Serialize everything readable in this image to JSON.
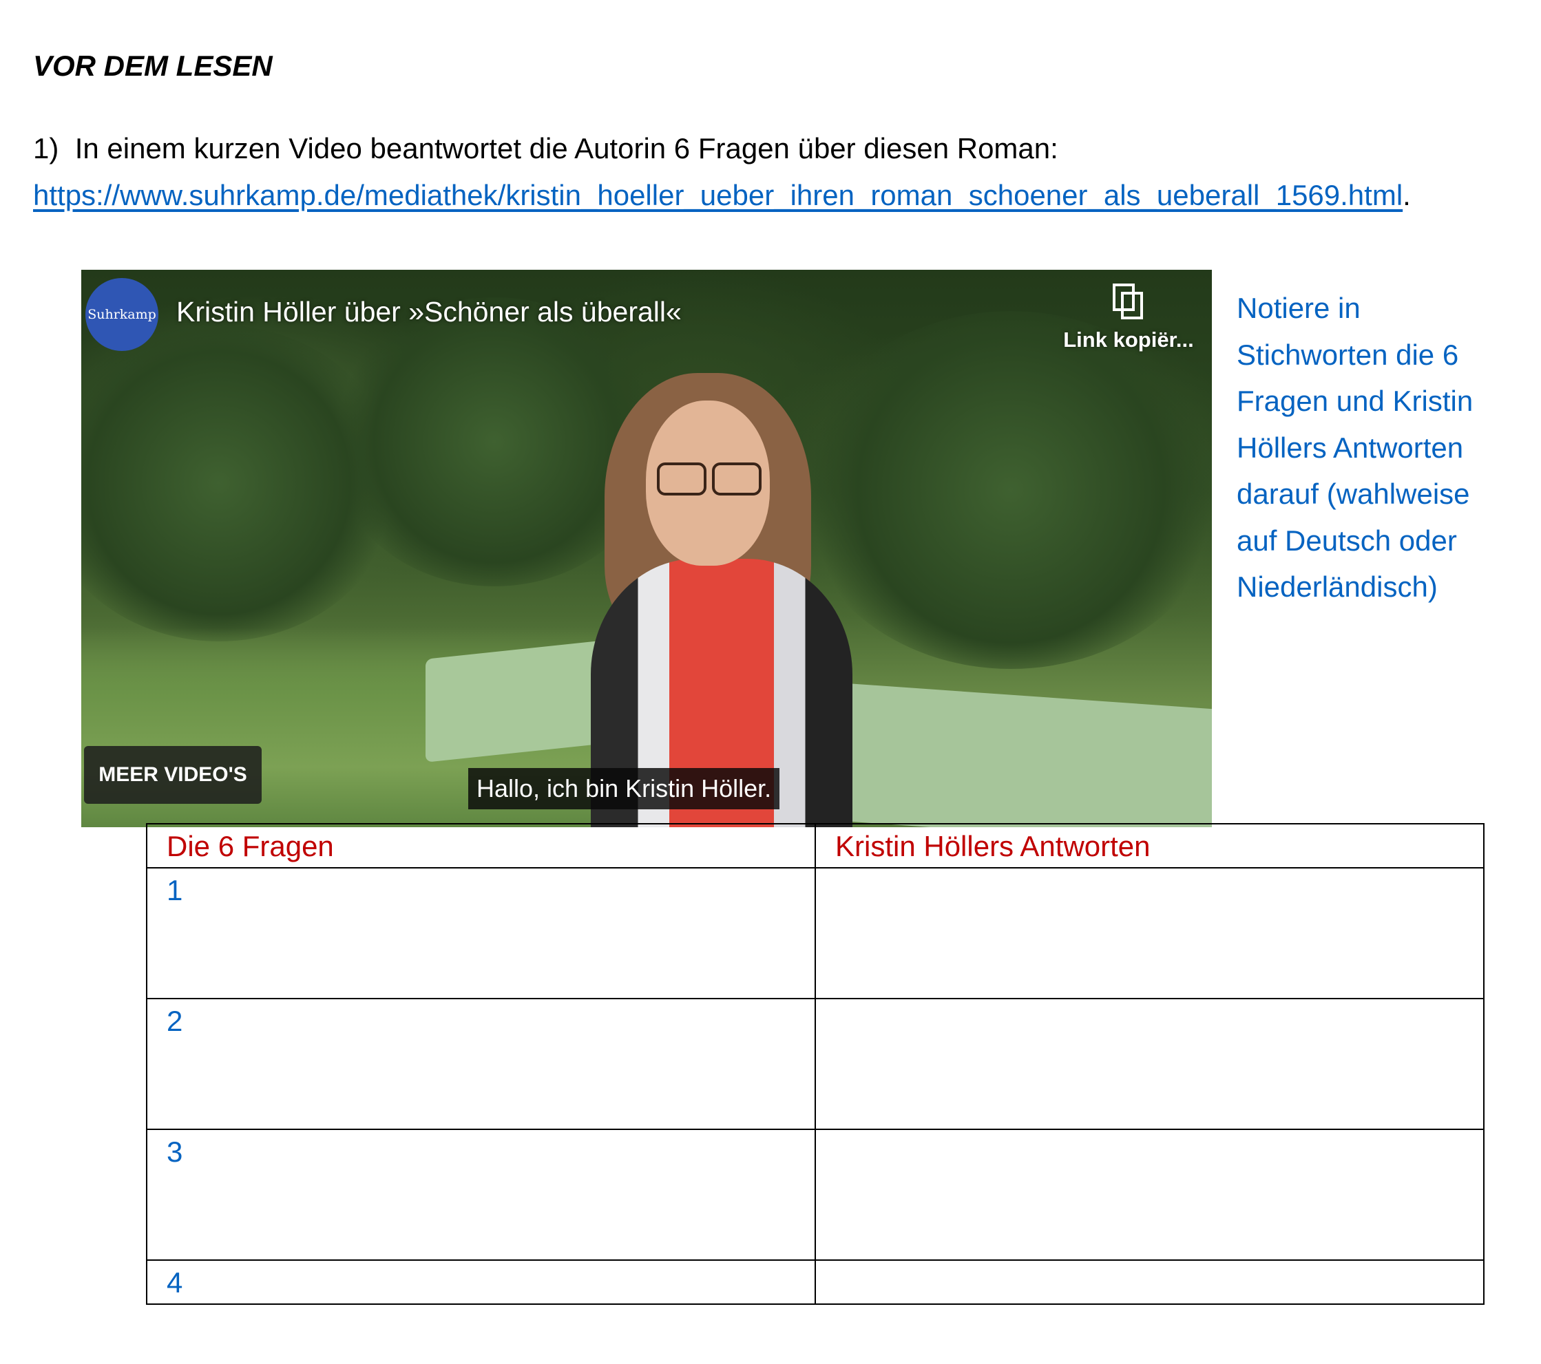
{
  "heading": "VOR DEM LESEN",
  "task": {
    "number": "1)",
    "text": "In einem kurzen Video beantwortet die Autorin 6 Fragen über diesen Roman:",
    "link": "https://www.suhrkamp.de/mediathek/kristin_hoeller_ueber_ihren_roman_schoener_als_ueberall_1569.html",
    "period": "."
  },
  "video": {
    "channel": "Suhrkamp",
    "title": "Kristin Höller über »Schöner als überall«",
    "copy_link_label": "Link kopiër...",
    "more_videos_label": "MEER VIDEO'S",
    "subtitle": "Hallo, ich bin Kristin Höller."
  },
  "note": "Notiere in Stichworten die 6 Fragen und Kristin Höllers Antworten darauf (wahlweise auf Deutsch oder Niederländisch)",
  "table": {
    "headers": [
      "Die 6 Fragen",
      "Kristin Höllers Antworten"
    ],
    "rows": [
      "1",
      "2",
      "3",
      "4"
    ]
  },
  "colors": {
    "link_blue": "#0563C1",
    "header_red": "#C00000",
    "channel_logo": "#2f56b4"
  }
}
